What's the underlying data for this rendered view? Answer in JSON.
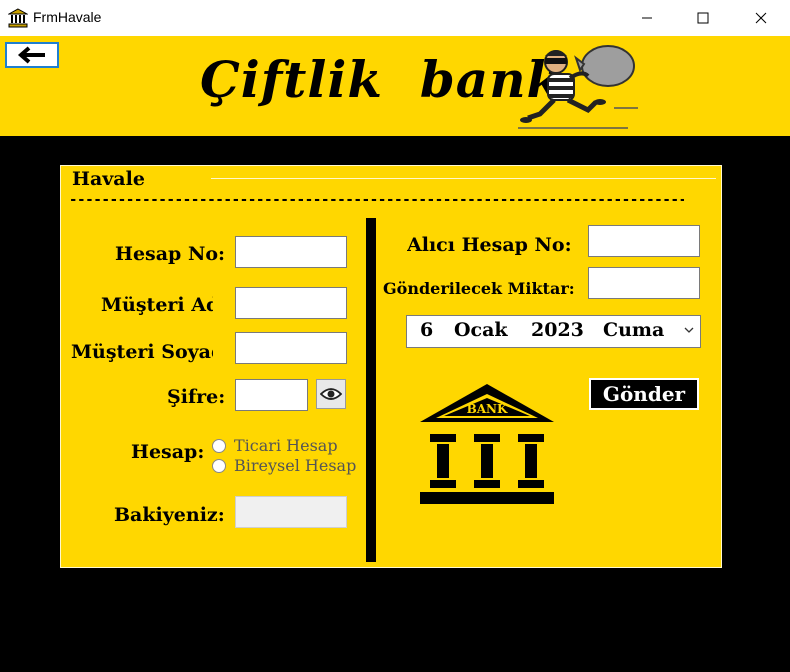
{
  "window": {
    "title": "FrmHavale",
    "icon": "bank-building-icon"
  },
  "header": {
    "brand": "Çiftlik  bank",
    "back_icon": "arrow-left-icon",
    "mascot": "thief-with-sack-illustration"
  },
  "panel": {
    "title": "Havale",
    "separator": "-------------------------------------------------------------------------------------"
  },
  "left": {
    "account_no_label": "Hesap No:",
    "customer_name_label": "Müşteri Ad",
    "customer_surname_label": "Müşteri Soyad",
    "password_label": "Şifre:",
    "account_type_label": "Hesap:",
    "account_types": [
      "Ticari Hesap",
      "Bireysel Hesap"
    ],
    "balance_label": "Bakiyeniz:"
  },
  "right": {
    "receiver_account_label": "Alıcı Hesap No:",
    "amount_label": "Gönderilecek Miktar:",
    "date": {
      "day": "6",
      "month": "Ocak",
      "year": "2023",
      "weekday": "Cuma"
    },
    "send_label": "Gönder",
    "bank_label": "BANK"
  },
  "colors": {
    "accent": "#FFD700",
    "background": "#000000"
  }
}
